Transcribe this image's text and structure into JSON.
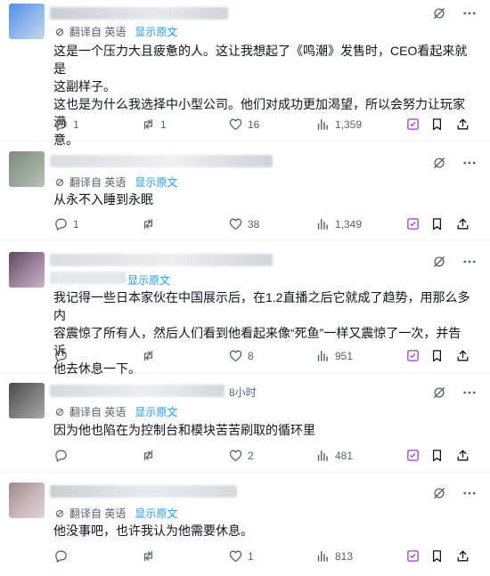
{
  "ui": {
    "translate_label": "翻译自 英语",
    "show_original_label": "显示原文",
    "accent_color": "#1d9bf0",
    "text_color": "#0f1419",
    "muted_color": "#536471",
    "icons": [
      "reply-icon",
      "retweet-icon",
      "like-icon",
      "views-icon",
      "grok-icon",
      "bookmark-icon",
      "share-icon",
      "more-icon",
      "translate-icon"
    ]
  },
  "tweets": [
    {
      "lines": [
        "这是一个压力大且疲惫的人。这让我想起了《鸣潮》发售时，CEO看起来就是",
        "这副样子。",
        "这也是为什么我选择中小型公司。他们对成功更加渴望，所以会努力让玩家满",
        "意。"
      ],
      "replies": "1",
      "retweets": "1",
      "likes": "16",
      "views": "1,359"
    },
    {
      "lines": [
        "从永不入睡到永眠"
      ],
      "replies": "1",
      "retweets": "",
      "likes": "38",
      "views": "1,349"
    },
    {
      "lines": [
        "我记得一些日本家伙在中国展示后，在1.2直播之后它就成了趋势，用那么多内",
        "容震惊了所有人，然后人们看到他看起来像“死鱼”一样又震惊了一次，并告诉",
        "他去休息一下。"
      ],
      "replies": "",
      "retweets": "",
      "likes": "8",
      "views": "951"
    },
    {
      "timestamp": "8小时",
      "lines": [
        "因为他也陷在为控制台和模块苦苦刷取的循环里"
      ],
      "replies": "",
      "retweets": "",
      "likes": "2",
      "views": "481"
    },
    {
      "lines": [
        "他没事吧，也许我认为他需要休息。"
      ],
      "replies": "",
      "retweets": "",
      "likes": "1",
      "views": "813"
    }
  ]
}
